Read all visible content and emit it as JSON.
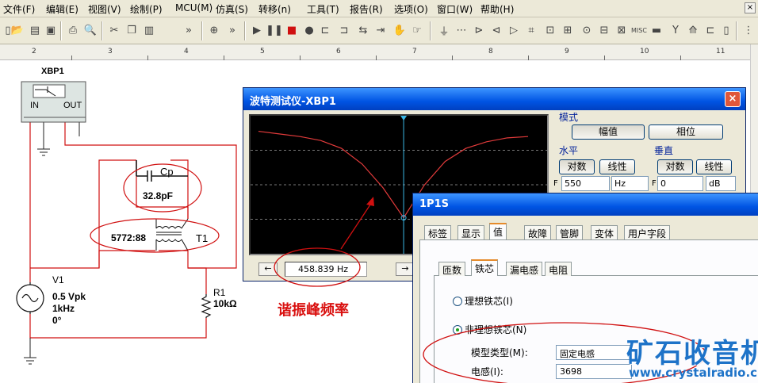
{
  "menu": [
    "文件(F)",
    "编辑(E)",
    "视图(V)",
    "绘制(P)",
    "MCU(M)",
    "仿真(S)",
    "转移(n)",
    "工具(T)",
    "报告(R)",
    "选项(O)",
    "窗口(W)",
    "帮助(H)"
  ],
  "ruler": [
    "2",
    "3",
    "4",
    "5",
    "6",
    "7",
    "8",
    "9",
    "10",
    "11"
  ],
  "schematic": {
    "xbp_ref": "XBP1",
    "xbp_in": "IN",
    "xbp_out": "OUT",
    "cap_ref": "Cp",
    "cap_value": "32.8pF",
    "transformer_ratio": "5772:88",
    "transformer_ref": "T1",
    "source_ref": "V1",
    "source_amp": "0.5 Vpk",
    "source_freq": "1kHz",
    "source_phase": "0°",
    "res_ref": "R1",
    "res_value": "10kΩ"
  },
  "bode": {
    "title": "波特测试仪-XBP1",
    "close": "×",
    "cursor_freq": "458.839 Hz",
    "arrow_left": "←",
    "arrow_right": "→",
    "mode_label": "模式",
    "btn_magnitude": "幅值",
    "btn_phase": "相位",
    "horizontal_label": "水平",
    "vertical_label": "垂直",
    "btn_log": "对数",
    "btn_linear": "线性",
    "f_label": "F",
    "h_f_value": "550",
    "h_f_unit": "Hz",
    "v_f_value": "0",
    "v_f_unit": "dB"
  },
  "dialog": {
    "title": "1P1S",
    "tabs": [
      "标签",
      "显示",
      "值",
      "故障",
      "管脚",
      "变体",
      "用户字段"
    ],
    "subtabs": [
      "匝数",
      "铁芯",
      "漏电感",
      "电阻"
    ],
    "radio_ideal": "理想铁芯(I)",
    "radio_nonideal": "非理想铁芯(N)",
    "model_type_label": "模型类型(M):",
    "model_type_value": "固定电感",
    "inductance_label": "电感(I):",
    "inductance_value": "3698"
  },
  "annotation": "谐振峰频率",
  "watermark": {
    "brand": "矿石收音机",
    "url": "www.crystalradio.cn"
  },
  "colors": {
    "wire": "#d01010",
    "trace": "#e33b3b",
    "cursor": "#3ab7e6",
    "annotation": "#d9100f",
    "watermark": "#1e73c8"
  },
  "chart_data": {
    "type": "line",
    "title": "",
    "xlabel": "",
    "ylabel": "",
    "xscale": "log",
    "grid": true,
    "series": [
      {
        "values": [
          0.91,
          0.89,
          0.87,
          0.84,
          0.78,
          0.66,
          0.48,
          0.25,
          0.5,
          0.68,
          0.78,
          0.83,
          0.86,
          0.87
        ]
      }
    ],
    "cursor_freq_hz": 458.839
  }
}
